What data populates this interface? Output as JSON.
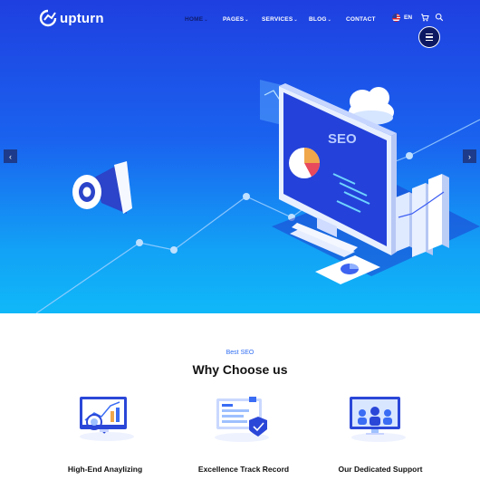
{
  "header": {
    "brand": "upturn",
    "nav": [
      {
        "label": "HOME",
        "dropdown": true
      },
      {
        "label": "PAGES",
        "dropdown": true
      },
      {
        "label": "SERVICES",
        "dropdown": true
      },
      {
        "label": "BLOG",
        "dropdown": true
      },
      {
        "label": "CONTACT",
        "dropdown": false
      }
    ],
    "language": "EN"
  },
  "hero": {
    "screen_label": "SEO",
    "icons": {
      "prev": "chevron-left-icon",
      "next": "chevron-right-icon"
    }
  },
  "section": {
    "eyebrow": "Best SEO",
    "title": "Why Choose us"
  },
  "features": [
    {
      "title": "High-End Anaylizing",
      "icon": "analytics-icon"
    },
    {
      "title": "Excellence Track Record",
      "icon": "track-record-icon"
    },
    {
      "title": "Our Dedicated Support",
      "icon": "support-icon"
    }
  ],
  "colors": {
    "accent": "#2f6df2",
    "hero_top": "#1f3fe0",
    "hero_bottom": "#10b8f8",
    "menu_dark": "#0d1a63"
  }
}
